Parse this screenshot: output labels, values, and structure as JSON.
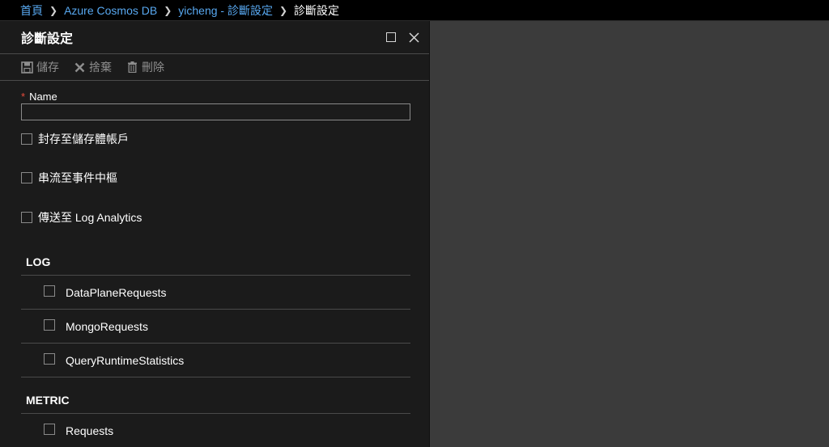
{
  "breadcrumb": {
    "items": [
      "首頁",
      "Azure Cosmos DB",
      "yicheng - 診斷設定"
    ],
    "current": "診斷設定"
  },
  "blade": {
    "title": "診斷設定",
    "maximize_icon": "maximize-icon",
    "close_icon": "close-icon"
  },
  "toolbar": {
    "save_label": "儲存",
    "discard_label": "捨棄",
    "delete_label": "刪除"
  },
  "form": {
    "required_mark": "*",
    "name_label": "Name",
    "name_value": "",
    "archive_label": "封存至儲存體帳戶",
    "stream_label": "串流至事件中樞",
    "send_label": "傳送至 Log Analytics"
  },
  "log": {
    "title": "LOG",
    "items": [
      "DataPlaneRequests",
      "MongoRequests",
      "QueryRuntimeStatistics"
    ]
  },
  "metric": {
    "title": "METRIC",
    "items": [
      "Requests"
    ]
  },
  "colors": {
    "link": "#58a8f0",
    "required": "#e74c3c",
    "panel_bg": "#1b1b1b",
    "page_bg": "#3a3a3a",
    "disabled_text": "#8e8e8e"
  }
}
